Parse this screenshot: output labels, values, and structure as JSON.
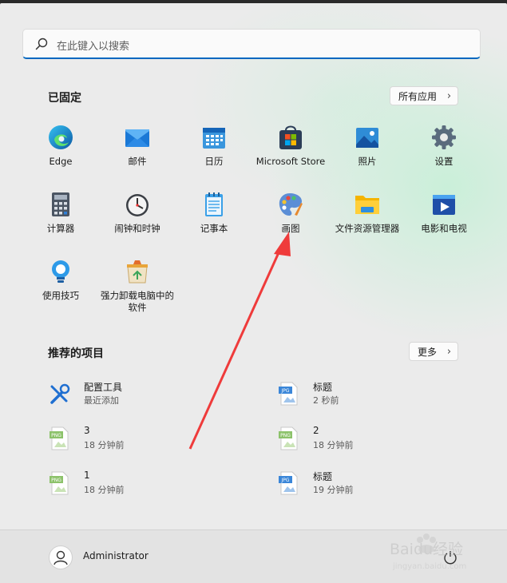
{
  "search": {
    "placeholder": "在此键入以搜索"
  },
  "pinned": {
    "title": "已固定",
    "all_apps_label": "所有应用",
    "apps": [
      {
        "label": "Edge",
        "icon": "edge-icon"
      },
      {
        "label": "邮件",
        "icon": "mail-icon"
      },
      {
        "label": "日历",
        "icon": "calendar-icon"
      },
      {
        "label": "Microsoft Store",
        "icon": "store-icon"
      },
      {
        "label": "照片",
        "icon": "photos-icon"
      },
      {
        "label": "设置",
        "icon": "settings-gear-icon"
      },
      {
        "label": "计算器",
        "icon": "calculator-icon"
      },
      {
        "label": "闹钟和时钟",
        "icon": "clock-icon"
      },
      {
        "label": "记事本",
        "icon": "notepad-icon"
      },
      {
        "label": "画图",
        "icon": "paint-palette-icon"
      },
      {
        "label": "文件资源管理器",
        "icon": "folder-icon"
      },
      {
        "label": "电影和电视",
        "icon": "movies-play-icon"
      },
      {
        "label": "使用技巧",
        "icon": "tips-bulb-icon"
      },
      {
        "label": "强力卸载电脑中的软件",
        "icon": "uninstall-box-icon"
      }
    ]
  },
  "recommended": {
    "title": "推荐的项目",
    "more_label": "更多",
    "items": [
      {
        "name": "配置工具",
        "detail": "最近添加",
        "icon": "tools-icon"
      },
      {
        "name": "标题",
        "detail": "2 秒前",
        "icon": "jpg-file-icon"
      },
      {
        "name": "3",
        "detail": "18 分钟前",
        "icon": "png-file-icon"
      },
      {
        "name": "2",
        "detail": "18 分钟前",
        "icon": "png-file-icon"
      },
      {
        "name": "1",
        "detail": "18 分钟前",
        "icon": "png-file-icon"
      },
      {
        "name": "标题",
        "detail": "19 分钟前",
        "icon": "jpg-file-icon"
      }
    ]
  },
  "footer": {
    "user_name": "Administrator"
  },
  "watermark": {
    "text": "Baidu经验",
    "url": "jingyan.baidu.com"
  },
  "colors": {
    "accent": "#0067c0",
    "arrow": "#ef3b3b"
  }
}
